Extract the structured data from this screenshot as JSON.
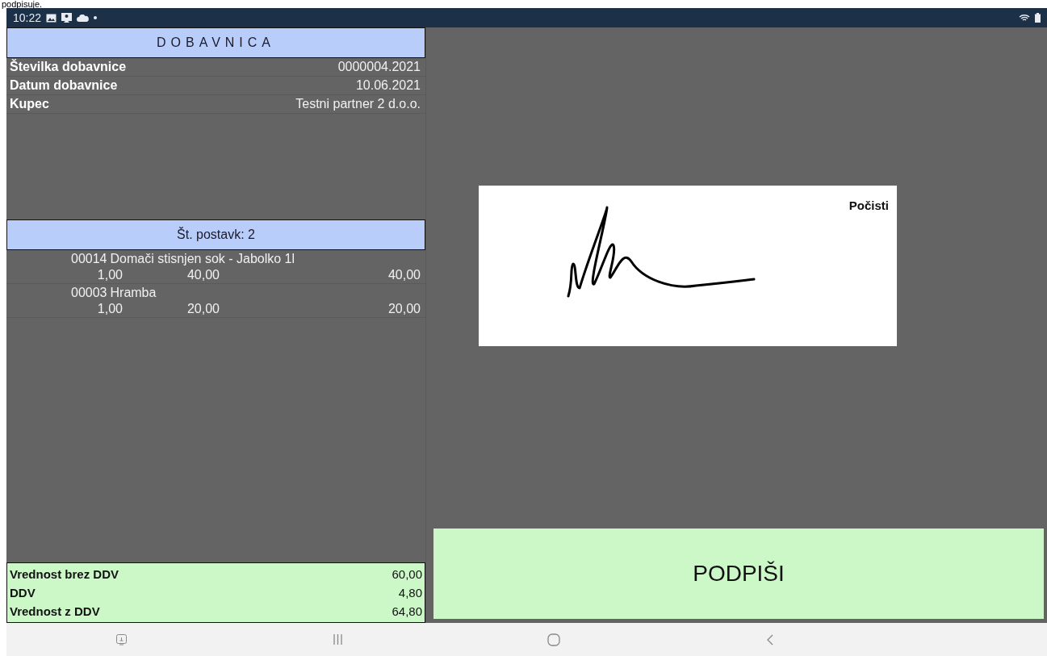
{
  "caption": "podpisuje.",
  "status_bar": {
    "time": "10:22"
  },
  "document": {
    "title": "DOBAVNICA",
    "fields": [
      {
        "label": "Številka dobavnice",
        "value": "0000004.2021"
      },
      {
        "label": "Datum dobavnice",
        "value": "10.06.2021"
      },
      {
        "label": "Kupec",
        "value": "Testni partner 2 d.o.o."
      }
    ],
    "items_header": "Št. postavk: 2",
    "items": [
      {
        "code": "00014",
        "name": "Domači stisnjen sok - Jabolko 1l",
        "quantity": "1,00",
        "price": "40,00",
        "amount": "40,00"
      },
      {
        "code": "00003",
        "name": "Hramba",
        "quantity": "1,00",
        "price": "20,00",
        "amount": "20,00"
      }
    ],
    "totals": [
      {
        "label": "Vrednost brez DDV",
        "value": "60,00"
      },
      {
        "label": "DDV",
        "value": "4,80"
      },
      {
        "label": "Vrednost z DDV",
        "value": "64,80"
      }
    ]
  },
  "signature": {
    "clear_label": "Počisti"
  },
  "sign_button": "PODPIŠI"
}
